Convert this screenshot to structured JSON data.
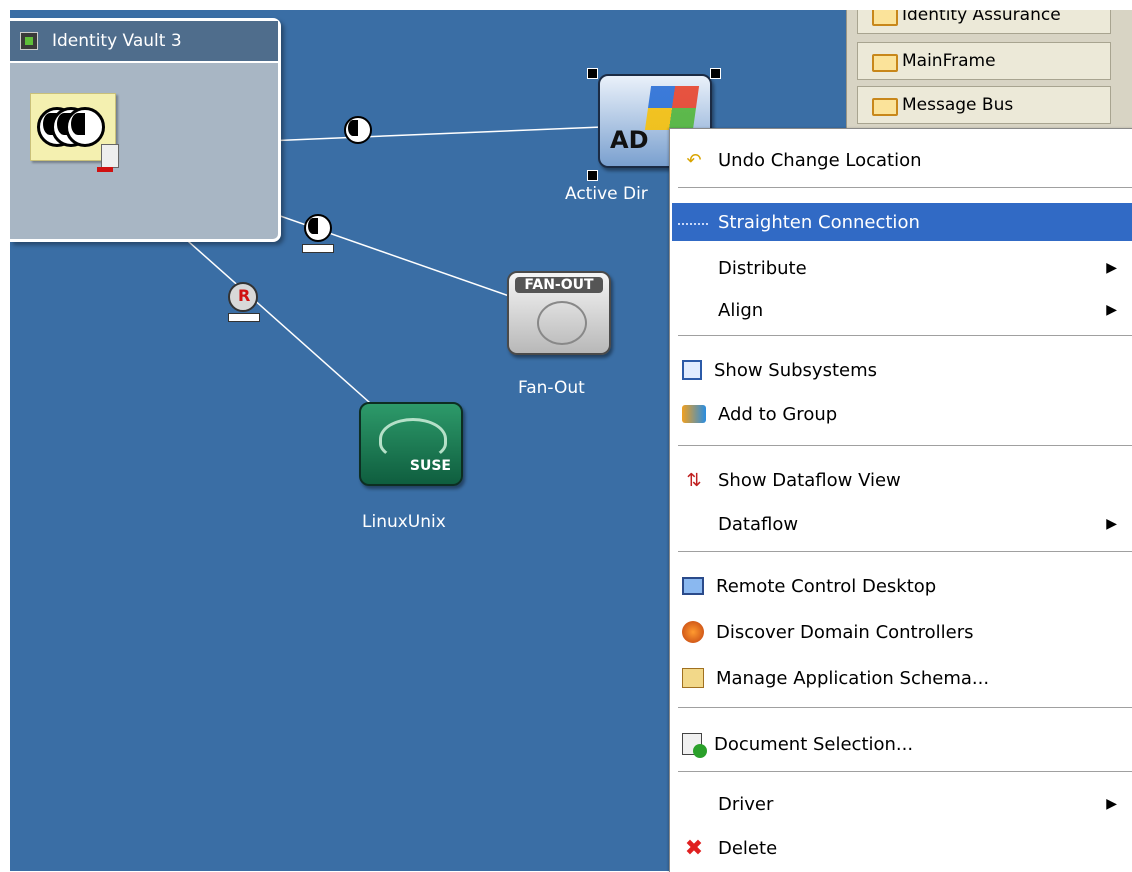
{
  "canvas": {
    "background": "#3a6ea5",
    "vault": {
      "title": "Identity Vault 3",
      "icon": "vault-icon",
      "node_icon": "yin-yang-stack-icon"
    },
    "nodes": [
      {
        "id": "active-directory",
        "label": "Active Dir",
        "icon": "active-directory-icon",
        "icon_text": "AD",
        "selected": true
      },
      {
        "id": "fan-out",
        "label": "Fan-Out",
        "icon": "fan-out-icon",
        "icon_text": "FAN-OUT"
      },
      {
        "id": "linuxunix",
        "label": "LinuxUnix",
        "icon": "opensuse-icon",
        "icon_text": "SUSE"
      }
    ],
    "connection_badges": [
      {
        "to": "active-directory",
        "icon": "yin-yang-icon"
      },
      {
        "to": "fan-out",
        "icon": "yin-yang-icon"
      },
      {
        "to": "linuxunix",
        "icon": "remote-loader-icon",
        "text": "R"
      }
    ]
  },
  "palette": {
    "items": [
      {
        "label": "Identity Assurance",
        "icon": "folder-icon"
      },
      {
        "label": "MainFrame",
        "icon": "folder-icon"
      },
      {
        "label": "Message Bus",
        "icon": "folder-icon"
      }
    ]
  },
  "context_menu": {
    "highlight_color": "#316ac5",
    "items": [
      {
        "label": "Undo Change Location",
        "icon": "undo-icon"
      },
      {
        "label": "Straighten Connection",
        "icon": "straighten-line-icon",
        "highlighted": true
      },
      {
        "label": "Distribute",
        "submenu": true
      },
      {
        "label": "Align",
        "submenu": true
      },
      {
        "label": "Show Subsystems",
        "icon": "subsystems-icon"
      },
      {
        "label": "Add to Group",
        "icon": "add-to-group-icon"
      },
      {
        "label": "Show Dataflow View",
        "icon": "dataflow-icon"
      },
      {
        "label": "Dataflow",
        "submenu": true
      },
      {
        "label": "Remote Control Desktop",
        "icon": "remote-desktop-icon"
      },
      {
        "label": "Discover Domain Controllers",
        "icon": "discover-icon"
      },
      {
        "label": "Manage Application Schema...",
        "icon": "schema-icon"
      },
      {
        "label": "Document Selection...",
        "icon": "document-icon"
      },
      {
        "label": "Driver",
        "submenu": true
      },
      {
        "label": "Delete",
        "icon": "delete-icon"
      }
    ],
    "submenu_arrow": "▶"
  }
}
